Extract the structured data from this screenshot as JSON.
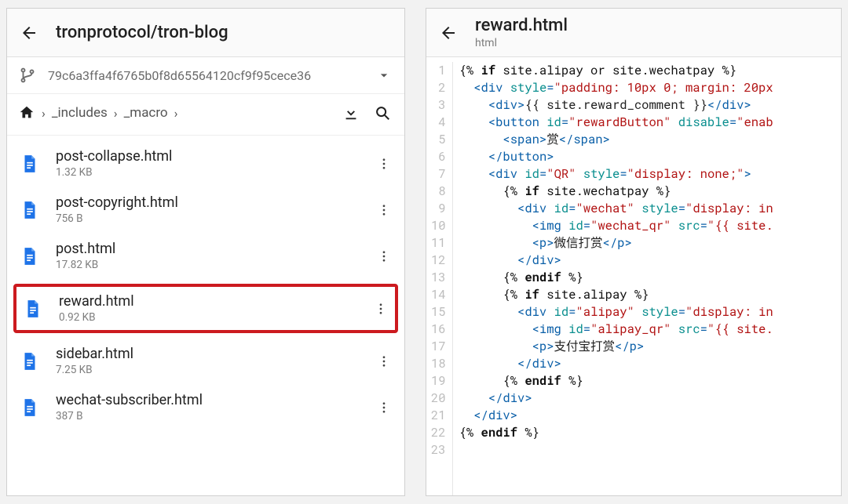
{
  "left": {
    "title": "tronprotocol/tron-blog",
    "commit_sha": "79c6a3ffa4f6765b0f8d65564120cf9f95cece36",
    "breadcrumbs": [
      "_includes",
      "_macro"
    ],
    "files": [
      {
        "name": "post-collapse.html",
        "size": "1.32 KB",
        "highlighted": false
      },
      {
        "name": "post-copyright.html",
        "size": "756 B",
        "highlighted": false
      },
      {
        "name": "post.html",
        "size": "17.82 KB",
        "highlighted": false
      },
      {
        "name": "reward.html",
        "size": "0.92 KB",
        "highlighted": true
      },
      {
        "name": "sidebar.html",
        "size": "7.25 KB",
        "highlighted": false
      },
      {
        "name": "wechat-subscriber.html",
        "size": "387 B",
        "highlighted": false
      }
    ]
  },
  "right": {
    "title": "reward.html",
    "subtitle": "html",
    "code_lines": [
      [
        {
          "t": "tmpl",
          "s": "{% "
        },
        {
          "t": "tmplk",
          "s": "if"
        },
        {
          "t": "tmpl",
          "s": " site.alipay or site.wechatpay %}"
        }
      ],
      [
        {
          "t": "ind",
          "s": "  "
        },
        {
          "t": "tag",
          "s": "<div "
        },
        {
          "t": "attr",
          "s": "style"
        },
        {
          "t": "tag",
          "s": "="
        },
        {
          "t": "str",
          "s": "\"padding: 10px 0; margin: 20px"
        }
      ],
      [
        {
          "t": "ind",
          "s": "    "
        },
        {
          "t": "tag",
          "s": "<div>"
        },
        {
          "t": "txt",
          "s": "{{ site.reward_comment }}"
        },
        {
          "t": "tag",
          "s": "</div>"
        }
      ],
      [
        {
          "t": "ind",
          "s": "    "
        },
        {
          "t": "tag",
          "s": "<button "
        },
        {
          "t": "attr",
          "s": "id"
        },
        {
          "t": "tag",
          "s": "="
        },
        {
          "t": "str",
          "s": "\"rewardButton\""
        },
        {
          "t": "tag",
          "s": " "
        },
        {
          "t": "attr",
          "s": "disable"
        },
        {
          "t": "tag",
          "s": "="
        },
        {
          "t": "str",
          "s": "\"enab"
        }
      ],
      [
        {
          "t": "ind",
          "s": "      "
        },
        {
          "t": "tag",
          "s": "<span>"
        },
        {
          "t": "txt",
          "s": "赏"
        },
        {
          "t": "tag",
          "s": "</span>"
        }
      ],
      [
        {
          "t": "ind",
          "s": "    "
        },
        {
          "t": "tag",
          "s": "</button>"
        }
      ],
      [
        {
          "t": "ind",
          "s": "    "
        },
        {
          "t": "tag",
          "s": "<div "
        },
        {
          "t": "attr",
          "s": "id"
        },
        {
          "t": "tag",
          "s": "="
        },
        {
          "t": "str",
          "s": "\"QR\""
        },
        {
          "t": "tag",
          "s": " "
        },
        {
          "t": "attr",
          "s": "style"
        },
        {
          "t": "tag",
          "s": "="
        },
        {
          "t": "str",
          "s": "\"display: none;\""
        },
        {
          "t": "tag",
          "s": ">"
        }
      ],
      [
        {
          "t": "ind",
          "s": "      "
        },
        {
          "t": "tmpl",
          "s": "{% "
        },
        {
          "t": "tmplk",
          "s": "if"
        },
        {
          "t": "tmpl",
          "s": " site.wechatpay %}"
        }
      ],
      [
        {
          "t": "ind",
          "s": "        "
        },
        {
          "t": "tag",
          "s": "<div "
        },
        {
          "t": "attr",
          "s": "id"
        },
        {
          "t": "tag",
          "s": "="
        },
        {
          "t": "str",
          "s": "\"wechat\""
        },
        {
          "t": "tag",
          "s": " "
        },
        {
          "t": "attr",
          "s": "style"
        },
        {
          "t": "tag",
          "s": "="
        },
        {
          "t": "str",
          "s": "\"display: in"
        }
      ],
      [
        {
          "t": "ind",
          "s": "          "
        },
        {
          "t": "tag",
          "s": "<img "
        },
        {
          "t": "attr",
          "s": "id"
        },
        {
          "t": "tag",
          "s": "="
        },
        {
          "t": "str",
          "s": "\"wechat_qr\""
        },
        {
          "t": "tag",
          "s": " "
        },
        {
          "t": "attr",
          "s": "src"
        },
        {
          "t": "tag",
          "s": "="
        },
        {
          "t": "str",
          "s": "\"{{ site."
        }
      ],
      [
        {
          "t": "ind",
          "s": "          "
        },
        {
          "t": "tag",
          "s": "<p>"
        },
        {
          "t": "txt",
          "s": "微信打赏"
        },
        {
          "t": "tag",
          "s": "</p>"
        }
      ],
      [
        {
          "t": "ind",
          "s": "        "
        },
        {
          "t": "tag",
          "s": "</div>"
        }
      ],
      [
        {
          "t": "ind",
          "s": "      "
        },
        {
          "t": "tmpl",
          "s": "{% "
        },
        {
          "t": "tmplk",
          "s": "endif"
        },
        {
          "t": "tmpl",
          "s": " %}"
        }
      ],
      [
        {
          "t": "ind",
          "s": "      "
        },
        {
          "t": "tmpl",
          "s": "{% "
        },
        {
          "t": "tmplk",
          "s": "if"
        },
        {
          "t": "tmpl",
          "s": " site.alipay %}"
        }
      ],
      [
        {
          "t": "ind",
          "s": "        "
        },
        {
          "t": "tag",
          "s": "<div "
        },
        {
          "t": "attr",
          "s": "id"
        },
        {
          "t": "tag",
          "s": "="
        },
        {
          "t": "str",
          "s": "\"alipay\""
        },
        {
          "t": "tag",
          "s": " "
        },
        {
          "t": "attr",
          "s": "style"
        },
        {
          "t": "tag",
          "s": "="
        },
        {
          "t": "str",
          "s": "\"display: in"
        }
      ],
      [
        {
          "t": "ind",
          "s": "          "
        },
        {
          "t": "tag",
          "s": "<img "
        },
        {
          "t": "attr",
          "s": "id"
        },
        {
          "t": "tag",
          "s": "="
        },
        {
          "t": "str",
          "s": "\"alipay_qr\""
        },
        {
          "t": "tag",
          "s": " "
        },
        {
          "t": "attr",
          "s": "src"
        },
        {
          "t": "tag",
          "s": "="
        },
        {
          "t": "str",
          "s": "\"{{ site."
        }
      ],
      [
        {
          "t": "ind",
          "s": "          "
        },
        {
          "t": "tag",
          "s": "<p>"
        },
        {
          "t": "txt",
          "s": "支付宝打赏"
        },
        {
          "t": "tag",
          "s": "</p>"
        }
      ],
      [
        {
          "t": "ind",
          "s": "        "
        },
        {
          "t": "tag",
          "s": "</div>"
        }
      ],
      [
        {
          "t": "ind",
          "s": "      "
        },
        {
          "t": "tmpl",
          "s": "{% "
        },
        {
          "t": "tmplk",
          "s": "endif"
        },
        {
          "t": "tmpl",
          "s": " %}"
        }
      ],
      [
        {
          "t": "ind",
          "s": "    "
        },
        {
          "t": "tag",
          "s": "</div>"
        }
      ],
      [
        {
          "t": "ind",
          "s": "  "
        },
        {
          "t": "tag",
          "s": "</div>"
        }
      ],
      [
        {
          "t": "tmpl",
          "s": "{% "
        },
        {
          "t": "tmplk",
          "s": "endif"
        },
        {
          "t": "tmpl",
          "s": " %}"
        }
      ],
      []
    ]
  }
}
